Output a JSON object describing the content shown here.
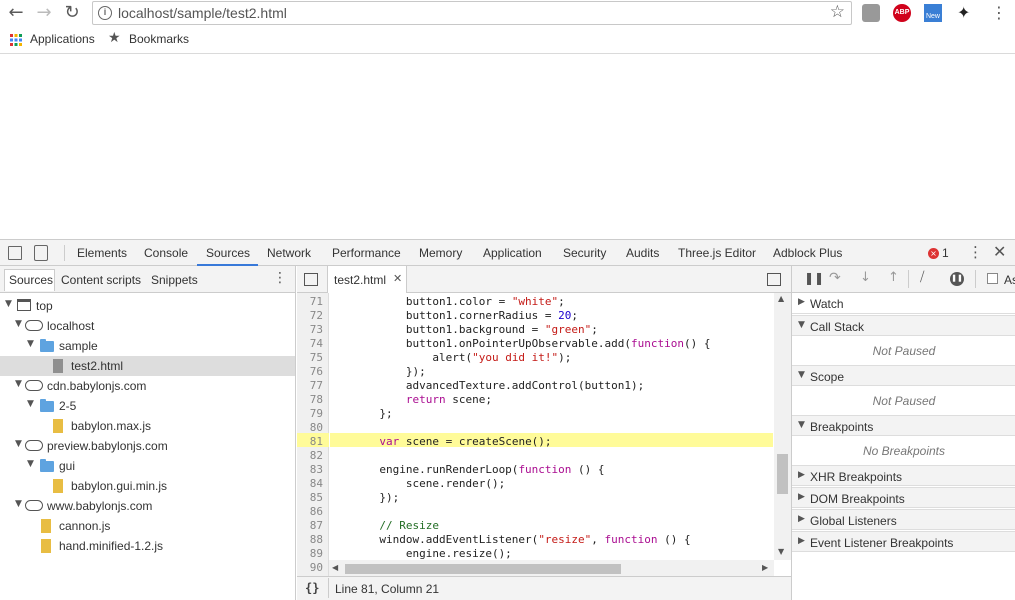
{
  "browser": {
    "url": "localhost/sample/test2.html",
    "extensions": [
      "ABP",
      "New"
    ]
  },
  "bookmarks": {
    "apps_label": "Applications",
    "bookmarks_label": "Bookmarks"
  },
  "devtools": {
    "tabs": [
      "Elements",
      "Console",
      "Sources",
      "Network",
      "Performance",
      "Memory",
      "Application",
      "Security",
      "Audits",
      "Three.js Editor",
      "Adblock Plus"
    ],
    "active_tab": "Sources",
    "error_count": "1",
    "nav_subtabs": [
      "Sources",
      "Content scripts",
      "Snippets"
    ],
    "tree": [
      {
        "label": "top",
        "icon": "frame-icon",
        "depth": 0
      },
      {
        "label": "localhost",
        "icon": "cloud-icon",
        "depth": 1
      },
      {
        "label": "sample",
        "icon": "folder-icon",
        "depth": 2
      },
      {
        "label": "test2.html",
        "icon": "html-file-icon",
        "depth": 3
      },
      {
        "label": "cdn.babylonjs.com",
        "icon": "cloud-icon",
        "depth": 1
      },
      {
        "label": "2-5",
        "icon": "folder-icon",
        "depth": 2
      },
      {
        "label": "babylon.max.js",
        "icon": "js-file-icon",
        "depth": 3
      },
      {
        "label": "preview.babylonjs.com",
        "icon": "cloud-icon",
        "depth": 1
      },
      {
        "label": "gui",
        "icon": "folder-icon",
        "depth": 2
      },
      {
        "label": "babylon.gui.min.js",
        "icon": "js-file-icon",
        "depth": 3
      },
      {
        "label": "www.babylonjs.com",
        "icon": "cloud-icon",
        "depth": 1
      },
      {
        "label": "cannon.js",
        "icon": "js-file-icon",
        "depth": 2
      },
      {
        "label": "hand.minified-1.2.js",
        "icon": "js-file-icon",
        "depth": 2
      }
    ],
    "editor": {
      "file_tab": "test2.html",
      "line_numbers": [
        "71",
        "72",
        "73",
        "74",
        "75",
        "76",
        "77",
        "78",
        "79",
        "80",
        "81",
        "82",
        "83",
        "84",
        "85",
        "86",
        "87",
        "88",
        "89",
        "90"
      ],
      "highlighted_line": "81",
      "status_text": "Line 81, Column 21",
      "format_icon": "{}"
    },
    "debugger": {
      "sections": {
        "watch": "Watch",
        "call_stack": "Call Stack",
        "call_stack_msg": "Not Paused",
        "scope": "Scope",
        "scope_msg": "Not Paused",
        "breakpoints": "Breakpoints",
        "breakpoints_msg": "No Breakpoints",
        "xhr": "XHR Breakpoints",
        "dom": "DOM Breakpoints",
        "global": "Global Listeners",
        "event": "Event Listener Breakpoints"
      },
      "async_label": "As"
    }
  }
}
